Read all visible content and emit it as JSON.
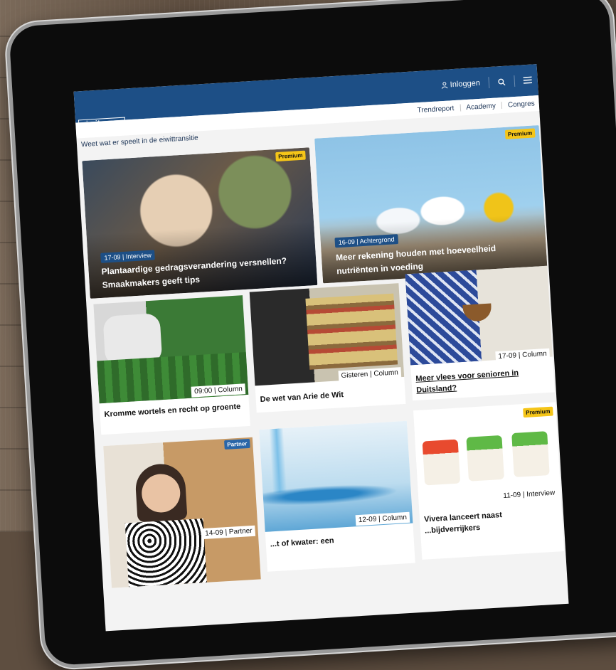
{
  "site": {
    "logo_line1": "eiwit",
    "logo_line2": "trends",
    "login_label": "Inloggen",
    "tagline": "Weet wat er speelt in de eiwittransitie",
    "nav": [
      "Trendreport",
      "Academy",
      "Congres"
    ]
  },
  "hero": [
    {
      "meta": "17-09 | Interview",
      "title": "Plantaardige gedragsverandering versnellen? Smaakmakers geeft tips",
      "badge": "Premium"
    },
    {
      "meta": "16-09 | Achtergrond",
      "title": "Meer rekening houden met hoeveelheid nutriënten in voeding",
      "badge": "Premium"
    }
  ],
  "cards": [
    {
      "meta": "09:00 | Column",
      "title": "Kromme wortels en recht op groente"
    },
    {
      "meta": "Gisteren | Column",
      "title": "De wet van Arie de Wit"
    },
    {
      "meta": "17-09 | Column",
      "title": "Meer vlees voor senioren in Duitsland?"
    },
    {
      "meta": "14-09 | Partner",
      "title": "",
      "badge": "Partner"
    },
    {
      "meta": "12-09 | Column",
      "title": "...t of kwater: een"
    },
    {
      "meta": "11-09 | Interview",
      "title": "Vivera lanceert naast ...bijdverrijkers",
      "badge": "Premium"
    }
  ],
  "colors": {
    "brand": "#1d4f86",
    "premium": "#f5c518"
  }
}
